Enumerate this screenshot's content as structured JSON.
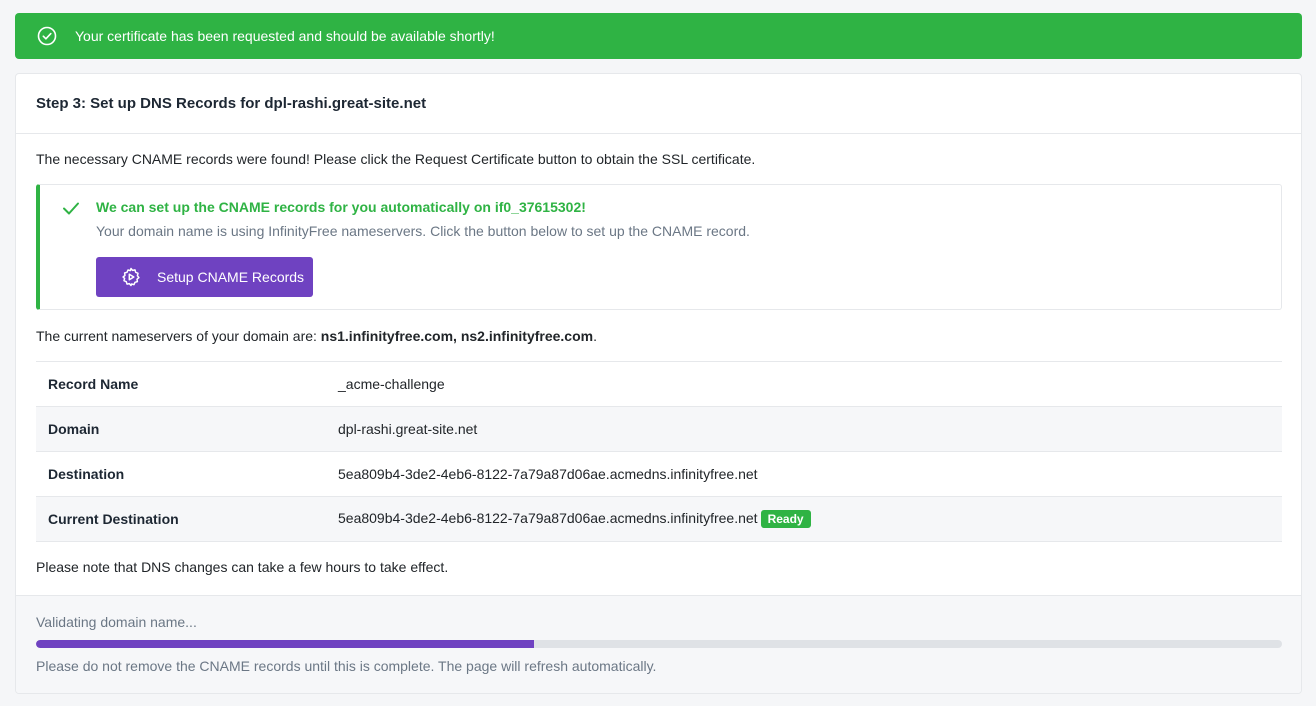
{
  "alert": {
    "message": "Your certificate has been requested and should be available shortly!",
    "icon": "check-circle-icon",
    "color": "#2fb344"
  },
  "card": {
    "title": "Step 3: Set up DNS Records for dpl-rashi.great-site.net",
    "intro": "The necessary CNAME records were found! Please click the Request Certificate button to obtain the SSL certificate.",
    "callout": {
      "heading": "We can set up the CNAME records for you automatically on if0_37615302!",
      "text": "Your domain name is using InfinityFree nameservers. Click the button below to set up the CNAME record.",
      "button_label": "Setup CNAME Records",
      "button_icon": "gear-play-icon",
      "accent": "#2fb344",
      "button_color": "#6f42c1"
    },
    "nameservers": {
      "prefix": "The current nameservers of your domain are: ",
      "value": "ns1.infinityfree.com, ns2.infinityfree.com",
      "suffix": "."
    },
    "records": [
      {
        "key": "Record Name",
        "value": "_acme-challenge"
      },
      {
        "key": "Domain",
        "value": "dpl-rashi.great-site.net"
      },
      {
        "key": "Destination",
        "value": "5ea809b4-3de2-4eb6-8122-7a79a87d06ae.acmedns.infinityfree.net"
      },
      {
        "key": "Current Destination",
        "value": "5ea809b4-3de2-4eb6-8122-7a79a87d06ae.acmedns.infinityfree.net",
        "badge": "Ready"
      }
    ],
    "note": "Please note that DNS changes can take a few hours to take effect."
  },
  "footer": {
    "status": "Validating domain name...",
    "progress_fraction": 0.4,
    "note": "Please do not remove the CNAME records until this is complete. The page will refresh automatically."
  }
}
